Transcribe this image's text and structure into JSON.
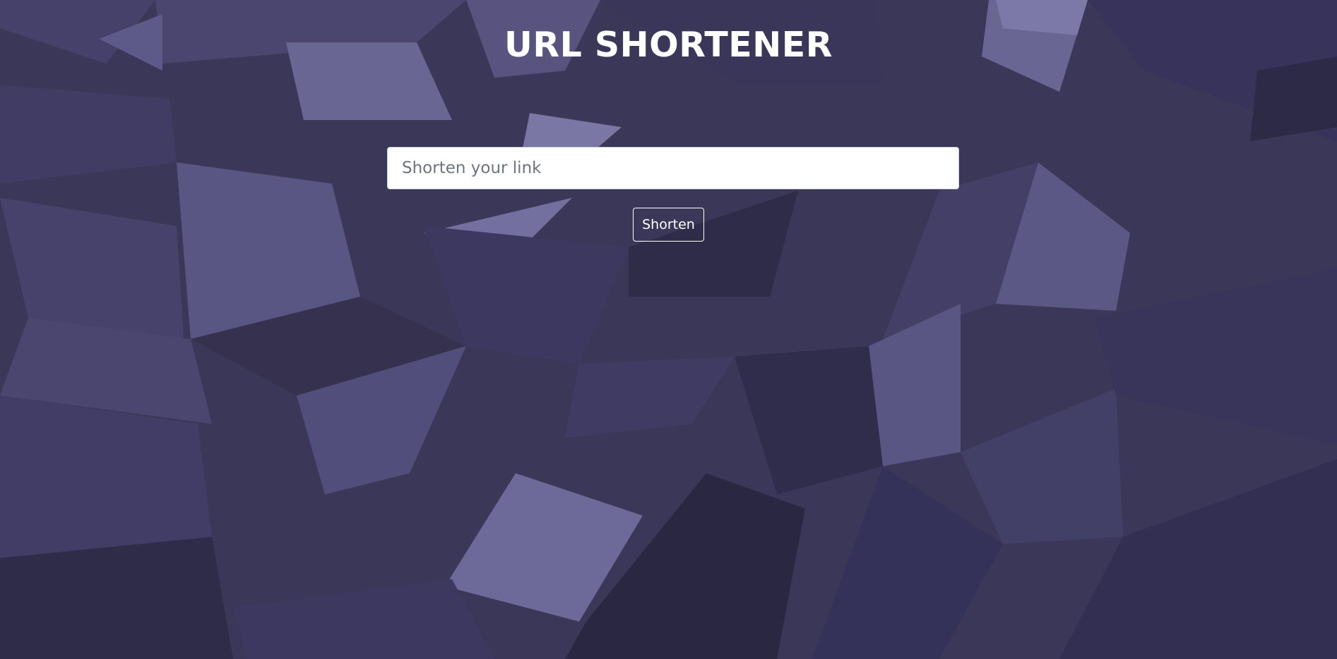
{
  "header": {
    "title": "URL SHORTENER"
  },
  "form": {
    "input_placeholder": "Shorten your link",
    "input_value": "",
    "button_label": "Shorten"
  },
  "theme": {
    "background": "#3b3758",
    "text": "#ffffff",
    "input_background": "#ffffff",
    "placeholder": "#6c757d"
  }
}
